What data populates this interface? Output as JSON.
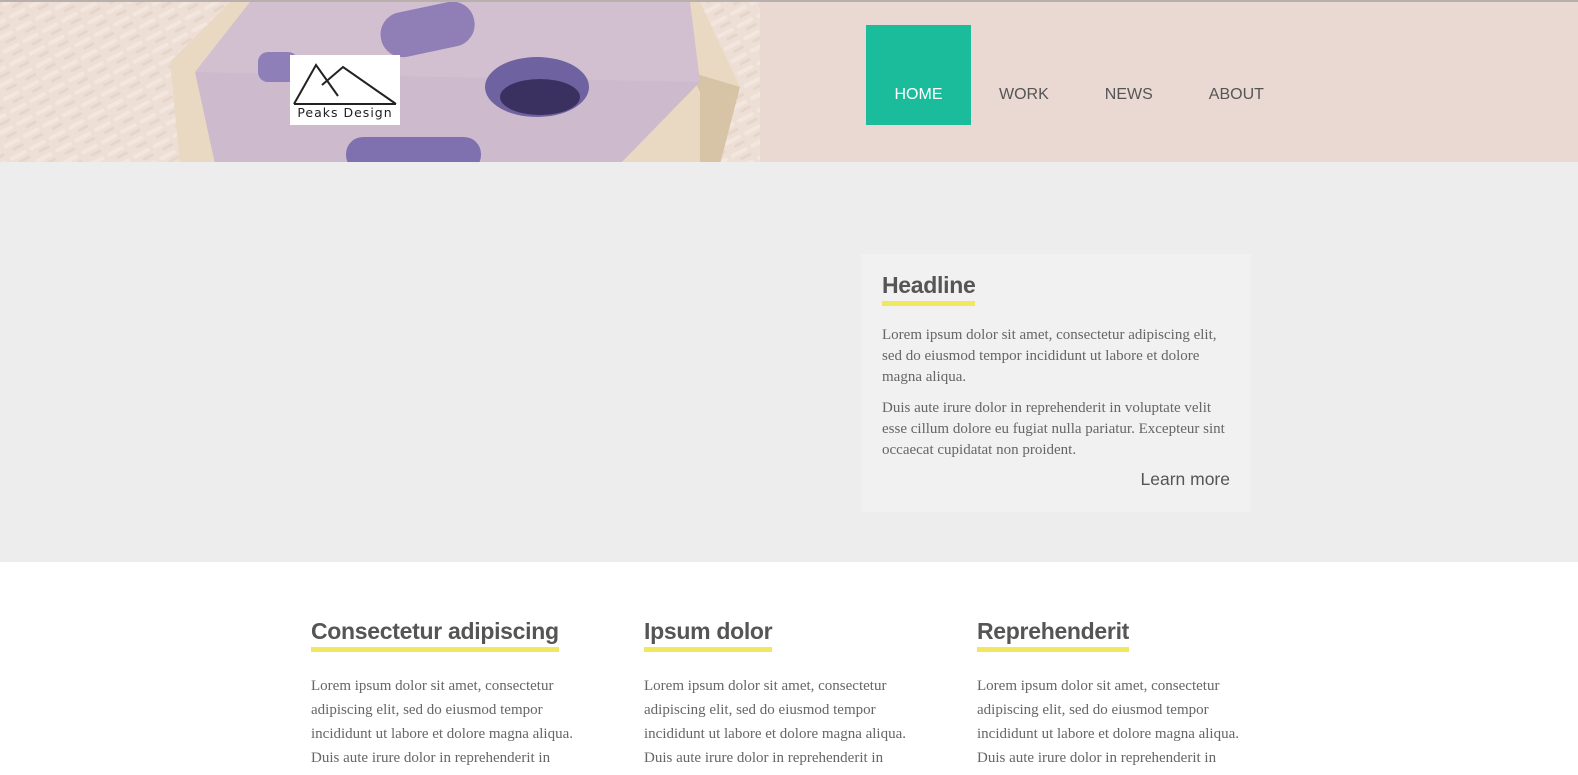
{
  "header": {
    "logo": {
      "text": "Peaks Design",
      "icon": "mountain-peaks-icon"
    },
    "nav": [
      {
        "label": "HOME",
        "active": true
      },
      {
        "label": "WORK",
        "active": false
      },
      {
        "label": "NEWS",
        "active": false
      },
      {
        "label": "ABOUT",
        "active": false
      }
    ]
  },
  "hero": {
    "title": "Headline",
    "paragraphs": [
      "Lorem ipsum dolor sit amet, consectetur adipiscing elit, sed do eiusmod tempor incididunt ut labore et dolore magna aliqua.",
      "Duis aute irure dolor in reprehenderit in voluptate velit esse cillum dolore eu fugiat nulla pariatur. Excepteur sint occaecat cupidatat non proident."
    ],
    "learn_more": "Learn more"
  },
  "columns": [
    {
      "title": "Consectetur adipiscing",
      "text": "Lorem ipsum dolor sit amet, consectetur adipiscing elit, sed do eiusmod tempor incididunt ut labore et dolore magna aliqua. Duis aute irure dolor in reprehenderit in"
    },
    {
      "title": "Ipsum dolor",
      "text": "Lorem ipsum dolor sit amet, consectetur adipiscing elit, sed do eiusmod tempor incididunt ut labore et dolore magna aliqua. Duis aute irure dolor in reprehenderit in"
    },
    {
      "title": "Reprehenderit",
      "text": "Lorem ipsum dolor sit amet, consectetur adipiscing elit, sed do eiusmod tempor incididunt ut labore et dolore magna aliqua. Duis aute irure dolor in reprehenderit in"
    }
  ],
  "colors": {
    "accent": "#1abc9c",
    "underline": "#f1e860",
    "band": "#ededed",
    "card": "#f1f1f1",
    "text": "#555555"
  }
}
